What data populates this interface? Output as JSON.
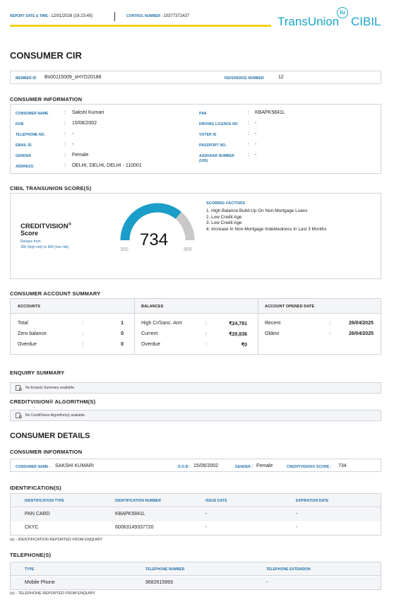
{
  "header": {
    "report_date_label": "REPORT DATE & TIME :",
    "report_date_value": "12/01/2026 (16:23:45)",
    "control_label": "CONTROL NUMBER :",
    "control_value": "10377372437",
    "logo_text_1": "TransUnion",
    "logo_text_2": "CIBIL",
    "logo_badge": "tu"
  },
  "title": "CONSUMER CIR",
  "member": {
    "member_id_label": "MEMBER ID",
    "member_id_value": "Bs00115009_sHYD20188",
    "reference_label": "REFERENCE NUMBER",
    "reference_value": "12"
  },
  "consumer_info": {
    "title": "CONSUMER INFORMATION",
    "left": [
      {
        "label": "CONSUMER NAME",
        "value": "Sakshi Kumari"
      },
      {
        "label": "DOB",
        "value": "15/06/2002"
      },
      {
        "label": "TELEPHONE NO.",
        "value": "-"
      },
      {
        "label": "EMAIL ID",
        "value": "-"
      },
      {
        "label": "GENDER",
        "value": "Female"
      },
      {
        "label": "ADDRESS",
        "value": "DELHI, DELHI, DELHI - 110001"
      }
    ],
    "right": [
      {
        "label": "PAN",
        "value": "KBAPK5841L"
      },
      {
        "label": "DRIVING LICENCE NO",
        "value": "-"
      },
      {
        "label": "VOTER ID",
        "value": "-"
      },
      {
        "label": "PASSPORT NO.",
        "value": "-"
      },
      {
        "label": "AADHAAR NUMBER (UID)",
        "value": "-"
      }
    ]
  },
  "score_section": {
    "title": "CIBIL TRANSUNION SCORE(S)",
    "brand_line1": "CREDITVISION",
    "brand_reg": "®",
    "brand_line2": "Score",
    "range_line1": "Ranges from",
    "range_line2": "300 (high risk) to 900 (low risk)",
    "score": "734",
    "min": "300",
    "max": "900",
    "score_fraction": 0.723,
    "factors_title": "SCORING FACTORS",
    "factors": [
      "1. High Balance Build-Up On Non-Mortgage Loans",
      "2. Low Credit Age",
      "3. Low Credit Age",
      "4. Increase In Non-Mortgage Indebtedness In Last 3 Months"
    ],
    "colors": {
      "arc": "#1a9ec9",
      "track": "#c8c8c8"
    }
  },
  "account_summary": {
    "title": "CONSUMER ACCOUNT SUMMARY",
    "accounts": {
      "header": "ACCOUNTS",
      "rows": [
        {
          "label": "Total",
          "value": "1"
        },
        {
          "label": "Zero balance",
          "value": "0"
        },
        {
          "label": "Overdue",
          "value": "0"
        }
      ]
    },
    "balances": {
      "header": "BALANCES",
      "rows": [
        {
          "label": "High Cr/Sanc. Amt",
          "value": "₹24,781"
        },
        {
          "label": "Current",
          "value": "₹20,836"
        },
        {
          "label": "Overdue",
          "value": "₹0"
        }
      ]
    },
    "opened": {
      "header": "ACCOUNT OPENED DATE",
      "rows": [
        {
          "label": "Recent",
          "value": "26/04/2025"
        },
        {
          "label": "Oldest",
          "value": "26/04/2025"
        }
      ]
    }
  },
  "enquiry": {
    "title": "ENQUIRY SUMMARY",
    "text": "No Enquiry Summary available."
  },
  "algorithm": {
    "title": "CREDITVISION® ALGORITHM(S)",
    "text": "No CreditVision Algorithm(s) available."
  },
  "details_title": "CONSUMER DETAILS",
  "consumer_details": {
    "title": "CONSUMER INFORMATION",
    "name_label": "CONSUMER NAME :",
    "name_value": "SAKSHI KUMARI",
    "dob_label": "D.O.B :",
    "dob_value": "15/06/2002",
    "gender_label": "GENDER :",
    "gender_value": "Female",
    "score_label": "CREDITVISION® SCORE :",
    "score_value": "734"
  },
  "identification": {
    "title": "IDENTIFICATION(S)",
    "headers": [
      "IDENTIFICATION TYPE",
      "IDENTIFICATION NUMBER",
      "ISSUE DATE",
      "EXPIRATION DATE"
    ],
    "rows": [
      [
        "PAN CARD",
        "KBAPK5841L",
        "-",
        "-"
      ],
      [
        "CKYC",
        "60063149337720",
        "-",
        "-"
      ]
    ],
    "note": "(e) - IDENTIFICATION REPORTED FROM ENQUIRY"
  },
  "telephone": {
    "title": "TELEPHONE(S)",
    "headers": [
      "TYPE",
      "TELEPHONE NUMBER",
      "TELEPHONE EXTENSION"
    ],
    "rows": [
      [
        "Mobile Phone",
        "9682615993",
        "-"
      ]
    ],
    "note": "(e) - TELEPHONE REPORTED FROM ENQUIRY"
  }
}
